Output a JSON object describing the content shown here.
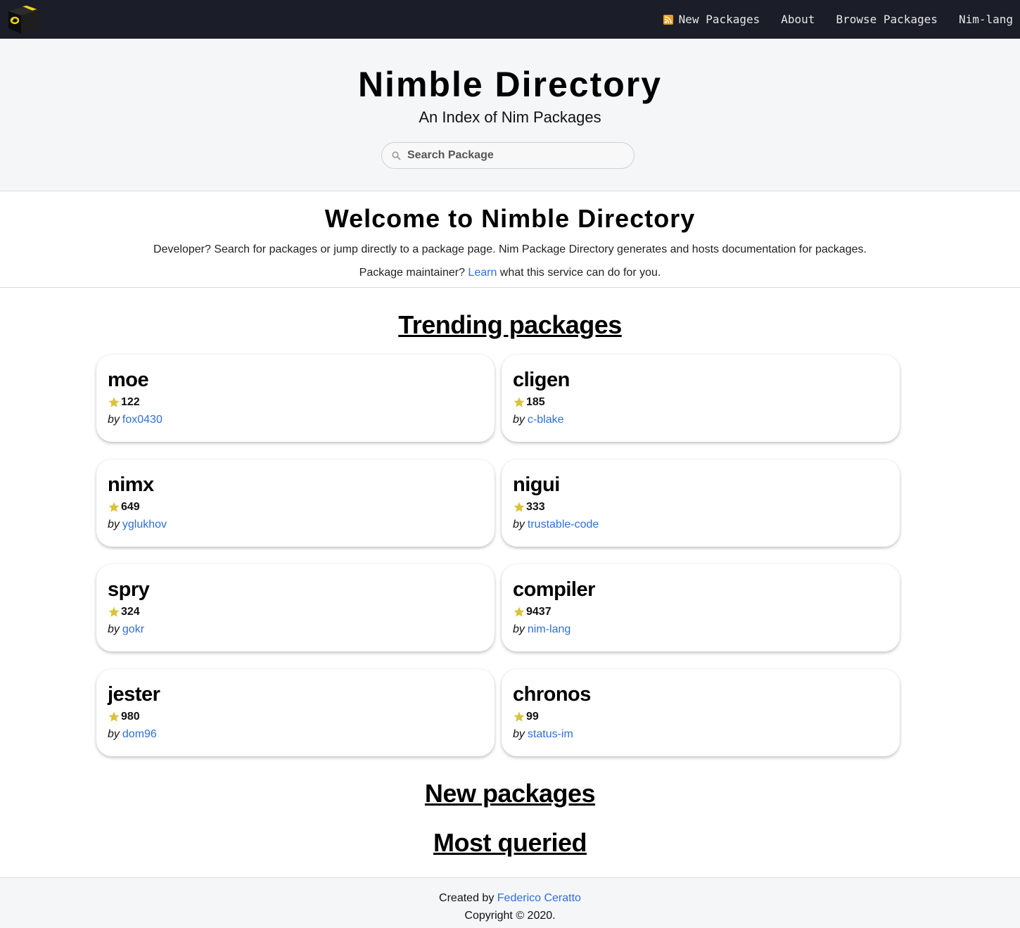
{
  "nav": {
    "items": [
      {
        "label": "New Packages",
        "icon": "rss-icon"
      },
      {
        "label": "About"
      },
      {
        "label": "Browse Packages"
      },
      {
        "label": "Nim-lang"
      }
    ]
  },
  "hero": {
    "title": "Nimble Directory",
    "subtitle": "An Index of Nim Packages",
    "search_placeholder": "Search Package"
  },
  "welcome": {
    "title": "Welcome to Nimble Directory",
    "paragraph1": "Developer? Search for packages or jump directly to a package page. Nim Package Directory generates and hosts documentation for packages.",
    "paragraph2_before": "Package maintainer? ",
    "paragraph2_link": "Learn",
    "paragraph2_after": " what this service can do for you."
  },
  "sections": {
    "trending": "Trending packages",
    "new": "New packages",
    "most_queried": "Most queried"
  },
  "by_label": "by",
  "packages": [
    {
      "name": "moe",
      "stars": "122",
      "author": "fox0430"
    },
    {
      "name": "cligen",
      "stars": "185",
      "author": "c-blake"
    },
    {
      "name": "nimx",
      "stars": "649",
      "author": "yglukhov"
    },
    {
      "name": "nigui",
      "stars": "333",
      "author": "trustable-code"
    },
    {
      "name": "spry",
      "stars": "324",
      "author": "gokr"
    },
    {
      "name": "compiler",
      "stars": "9437",
      "author": "nim-lang"
    },
    {
      "name": "jester",
      "stars": "980",
      "author": "dom96"
    },
    {
      "name": "chronos",
      "stars": "99",
      "author": "status-im"
    }
  ],
  "footer": {
    "created_by": "Created by ",
    "author_link": "Federico Ceratto",
    "copyright": "Copyright © 2020."
  },
  "colors": {
    "topbar": "#1b1d28",
    "link": "#2f6fd6",
    "star": "#d9c33a",
    "rss": "#f39c12"
  }
}
